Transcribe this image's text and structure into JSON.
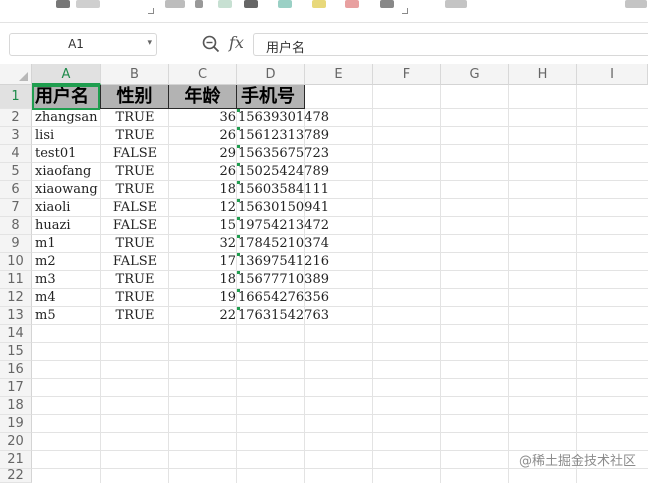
{
  "name_box": {
    "value": "A1"
  },
  "formula_bar": {
    "fx_label": "fx",
    "value": "用户名"
  },
  "columns": [
    "A",
    "B",
    "C",
    "D",
    "E",
    "F",
    "G",
    "H",
    "I"
  ],
  "rows": [
    "1",
    "2",
    "3",
    "4",
    "5",
    "6",
    "7",
    "8",
    "9",
    "10",
    "11",
    "12",
    "13",
    "14",
    "15",
    "16",
    "17",
    "18",
    "19",
    "20",
    "21",
    "22"
  ],
  "table": {
    "headers": [
      "用户名",
      "性别",
      "年龄",
      "手机号"
    ],
    "records": [
      [
        "zhangsan",
        "TRUE",
        "36",
        "15639301478"
      ],
      [
        "lisi",
        "TRUE",
        "26",
        "15612313789"
      ],
      [
        "test01",
        "FALSE",
        "29",
        "15635675723"
      ],
      [
        "xiaofang",
        "TRUE",
        "26",
        "15025424789"
      ],
      [
        "xiaowang",
        "TRUE",
        "18",
        "15603584111"
      ],
      [
        "xiaoli",
        "FALSE",
        "12",
        "15630150941"
      ],
      [
        "huazi",
        "FALSE",
        "15",
        "19754213472"
      ],
      [
        "m1",
        "TRUE",
        "32",
        "17845210374"
      ],
      [
        "m2",
        "FALSE",
        "17",
        "13697541216"
      ],
      [
        "m3",
        "TRUE",
        "18",
        "15677710389"
      ],
      [
        "m4",
        "TRUE",
        "19",
        "16654276356"
      ],
      [
        "m5",
        "TRUE",
        "22",
        "17631542763"
      ]
    ]
  },
  "watermark": "@稀土掘金技术社区",
  "colors": {
    "selection": "#1f9e4f",
    "header_fill": "#b3b3b3"
  }
}
